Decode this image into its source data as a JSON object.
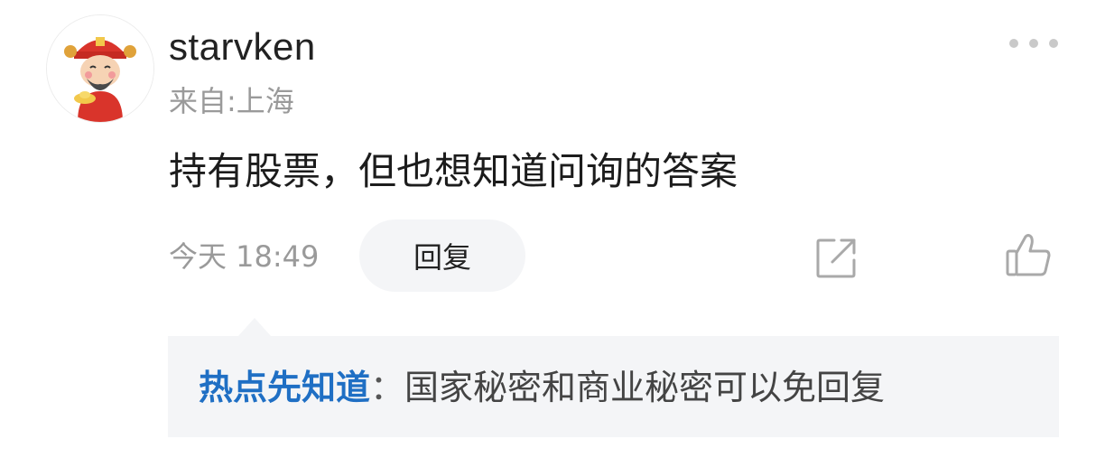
{
  "comment": {
    "username": "starvken",
    "location": "来自:上海",
    "content": "持有股票，但也想知道问询的答案",
    "time": "今天 18:49",
    "reply_label": "回复"
  },
  "answer": {
    "label": "热点先知道",
    "separator": "：",
    "text": "国家秘密和商业秘密可以免回复"
  },
  "colors": {
    "accent": "#1f6fc4",
    "muted": "#9a9a9a",
    "panel": "#f4f5f7"
  },
  "icons": [
    "avatar",
    "more-icon",
    "share-icon",
    "like-icon"
  ]
}
